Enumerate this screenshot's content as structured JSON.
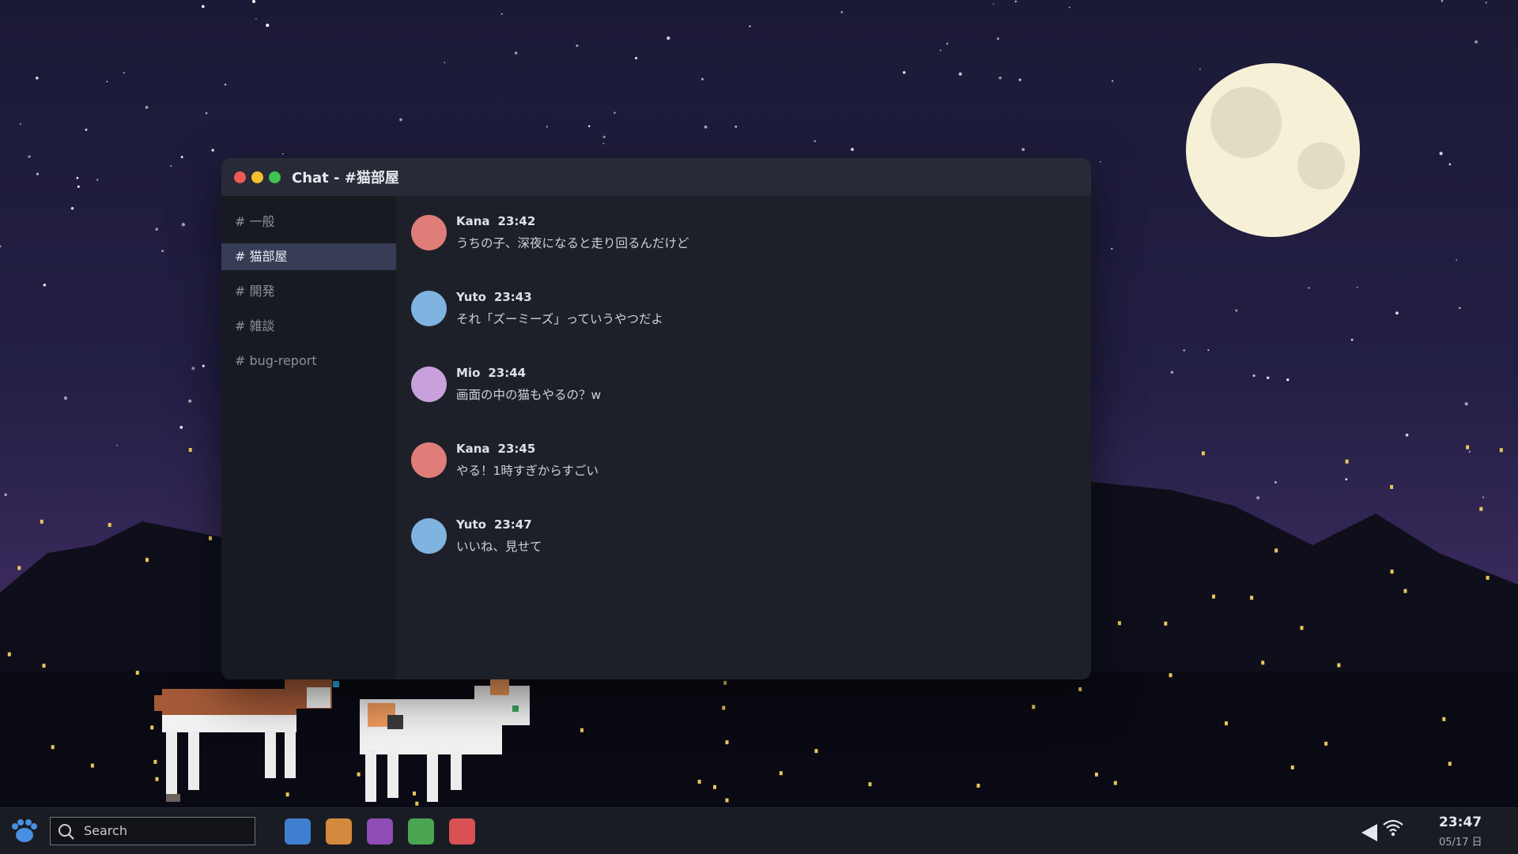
{
  "window": {
    "title": "Chat - #猫部屋"
  },
  "sidebar": {
    "channels": [
      {
        "label": "# 一般",
        "active": false
      },
      {
        "label": "# 猫部屋",
        "active": true
      },
      {
        "label": "# 開発",
        "active": false
      },
      {
        "label": "# 雑談",
        "active": false
      },
      {
        "label": "# bug-report",
        "active": false
      }
    ]
  },
  "messages": [
    {
      "author": "Kana",
      "time": "23:42",
      "text": "うちの子、深夜になると走り回るんだけど",
      "avatar_color": "#df7d78"
    },
    {
      "author": "Yuto",
      "time": "23:43",
      "text": "それ「ズーミーズ」っていうやつだよ",
      "avatar_color": "#7fb3e0"
    },
    {
      "author": "Mio",
      "time": "23:44",
      "text": "画面の中の猫もやるの？w",
      "avatar_color": "#c8a0dc"
    },
    {
      "author": "Kana",
      "time": "23:45",
      "text": "やる！1時すぎからすごい",
      "avatar_color": "#df7d78"
    },
    {
      "author": "Yuto",
      "time": "23:47",
      "text": "いいね、見せて",
      "avatar_color": "#7fb3e0"
    }
  ],
  "taskbar": {
    "launcher_icon": "paw-icon",
    "search_placeholder": "Search",
    "apps": [
      {
        "name": "blue-app",
        "color": "#3f7fcf"
      },
      {
        "name": "orange-app",
        "color": "#d38a3c"
      },
      {
        "name": "purple-app",
        "color": "#8f4cb5"
      },
      {
        "name": "green-app",
        "color": "#4aa553"
      },
      {
        "name": "red-app",
        "color": "#d85253"
      }
    ],
    "tray": [
      "volume-icon",
      "wifi-icon"
    ],
    "clock_time": "23:47",
    "clock_date": "05/17 日"
  }
}
